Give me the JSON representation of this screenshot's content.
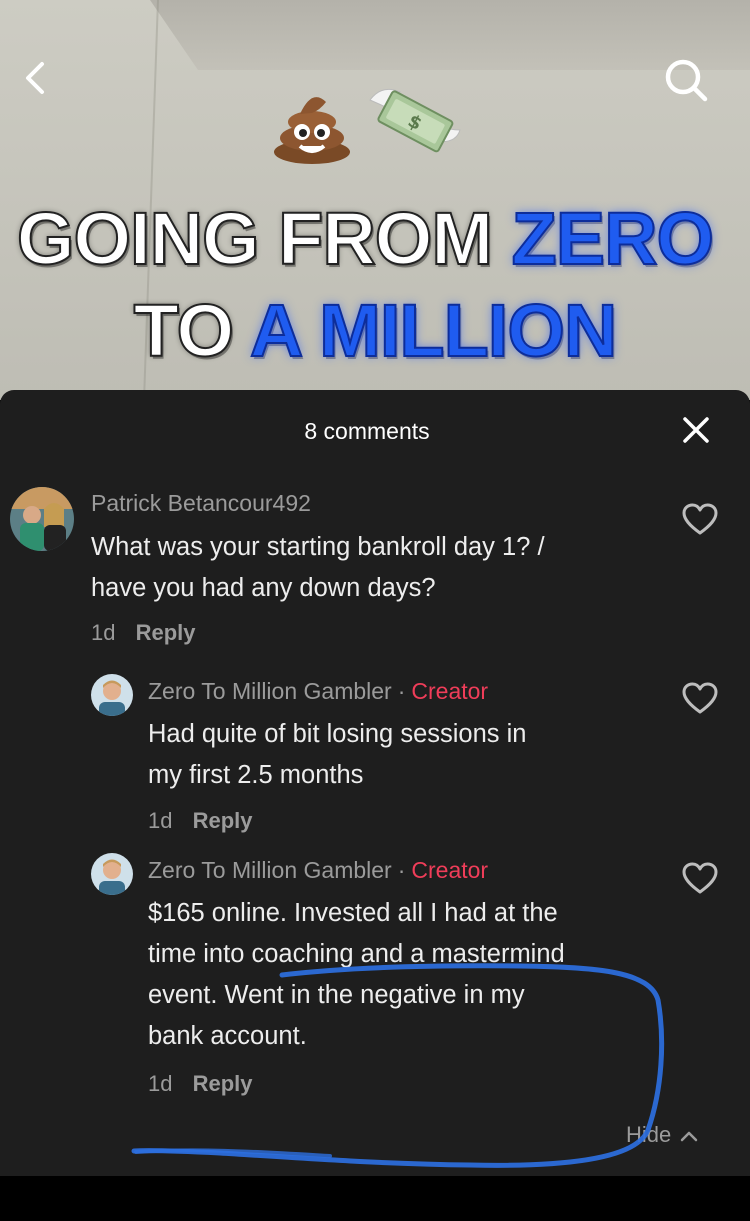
{
  "video": {
    "headline_line1_white": "GOING FROM",
    "headline_line1_blue": "ZERO",
    "headline_line2_white": "TO",
    "headline_line2_blue": "A MILLION",
    "emojis": [
      "poop-emoji",
      "money-with-wings-emoji"
    ]
  },
  "header": {
    "back_icon": "chevron-left-icon",
    "search_icon": "search-icon"
  },
  "comments_sheet": {
    "title": "8 comments",
    "close_icon": "close-icon",
    "hide_label": "Hide",
    "comments": [
      {
        "author": "Patrick Betancour492",
        "text_line1": "What was your starting bankroll day 1? /",
        "text_line2": "have you had any down days?",
        "age": "1d",
        "reply_label": "Reply"
      },
      {
        "author": "Zero To Million Gambler",
        "separator": "·",
        "badge": "Creator",
        "text_line1": "Had quite of bit losing sessions in",
        "text_line2": "my first 2.5 months",
        "age": "1d",
        "reply_label": "Reply"
      },
      {
        "author": "Zero To Million Gambler",
        "separator": "·",
        "badge": "Creator",
        "text_line1": "$165 online. Invested all I had at the",
        "text_line2": "time into coaching and a mastermind",
        "text_line3": "event. Went in the negative in my",
        "text_line4": "bank account.",
        "age": "1d",
        "reply_label": "Reply"
      }
    ]
  },
  "colors": {
    "sheet_bg": "#1e1e1e",
    "creator_red": "#ef3d59",
    "headline_blue": "#1f5cf0",
    "scribble_blue": "#2d6fe0"
  }
}
